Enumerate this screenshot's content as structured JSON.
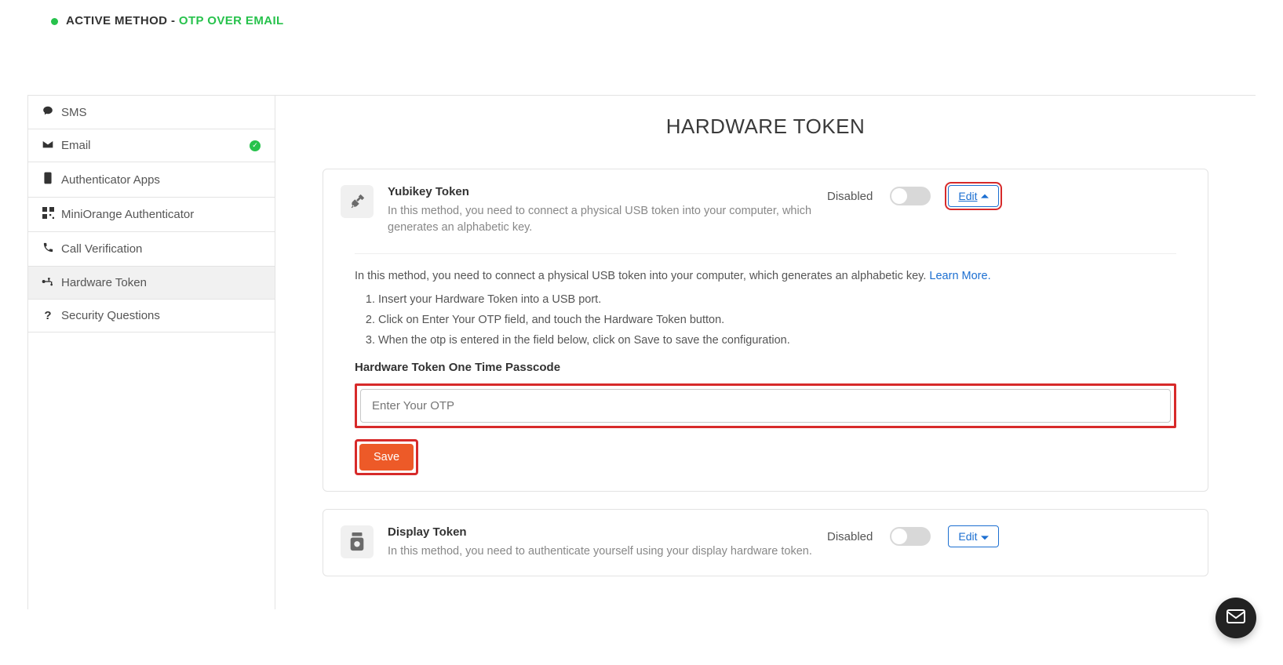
{
  "header": {
    "active_prefix": "ACTIVE METHOD - ",
    "active_value": "OTP OVER EMAIL"
  },
  "sidebar": {
    "items": [
      {
        "label": "SMS",
        "icon": "sms",
        "active": false,
        "check": false
      },
      {
        "label": "Email",
        "icon": "email",
        "active": false,
        "check": true
      },
      {
        "label": "Authenticator Apps",
        "icon": "phone-app",
        "active": false,
        "check": false
      },
      {
        "label": "MiniOrange Authenticator",
        "icon": "qr",
        "active": false,
        "check": false
      },
      {
        "label": "Call Verification",
        "icon": "phone",
        "active": false,
        "check": false
      },
      {
        "label": "Hardware Token",
        "icon": "usb",
        "active": true,
        "check": false
      },
      {
        "label": "Security Questions",
        "icon": "question",
        "active": false,
        "check": false
      }
    ]
  },
  "main": {
    "title": "HARDWARE TOKEN",
    "yubikey": {
      "title": "Yubikey Token",
      "desc": "In this method, you need to connect a physical USB token into your computer, which generates an alphabetic key.",
      "status": "Disabled",
      "edit_label": "Edit",
      "detail_para": "In this method, you need to connect a physical USB token into your computer, which generates an alphabetic key. ",
      "learn_more": "Learn More.",
      "steps": [
        "Insert your Hardware Token into a USB port.",
        "Click on Enter Your OTP field, and touch the Hardware Token button.",
        "When the otp is entered in the field below, click on Save to save the configuration."
      ],
      "field_label": "Hardware Token One Time Passcode",
      "placeholder": "Enter Your OTP",
      "save_label": "Save"
    },
    "display": {
      "title": "Display Token",
      "desc": "In this method, you need to authenticate yourself using your display hardware token.",
      "status": "Disabled",
      "edit_label": "Edit"
    }
  }
}
